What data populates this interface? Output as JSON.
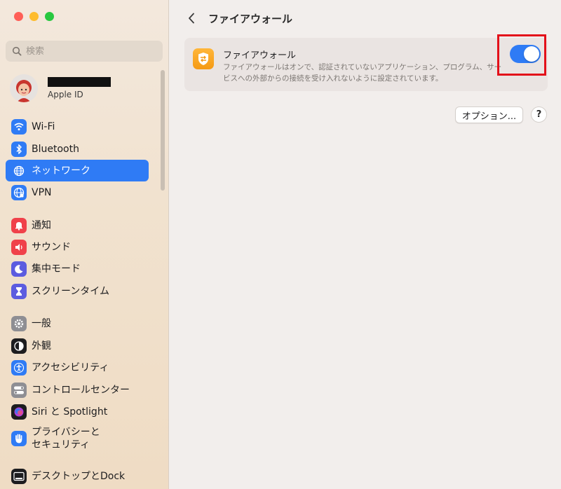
{
  "search": {
    "placeholder": "検索"
  },
  "account": {
    "subtitle": "Apple ID"
  },
  "sidebar": {
    "items": [
      {
        "label": "Wi-Fi",
        "icon": "wifi-icon",
        "color": "#2f7bf5"
      },
      {
        "label": "Bluetooth",
        "icon": "bluetooth-icon",
        "color": "#2f7bf5"
      },
      {
        "label": "ネットワーク",
        "icon": "globe-icon",
        "color": "#2f7bf5",
        "active": true
      },
      {
        "label": "VPN",
        "icon": "vpn-globe-icon",
        "color": "#2f7bf5"
      },
      {
        "label": "通知",
        "icon": "bell-icon",
        "color": "#f0414a"
      },
      {
        "label": "サウンド",
        "icon": "speaker-icon",
        "color": "#f0414a"
      },
      {
        "label": "集中モード",
        "icon": "moon-icon",
        "color": "#5c5ce0"
      },
      {
        "label": "スクリーンタイム",
        "icon": "hourglass-icon",
        "color": "#5c5ce0"
      },
      {
        "label": "一般",
        "icon": "gear-icon",
        "color": "#8e8e93"
      },
      {
        "label": "外観",
        "icon": "appearance-icon",
        "color": "#1d1d1f"
      },
      {
        "label": "アクセシビリティ",
        "icon": "accessibility-icon",
        "color": "#2f7bf5"
      },
      {
        "label": "コントロールセンター",
        "icon": "toggles-icon",
        "color": "#8e8e93"
      },
      {
        "label": "Siri と Spotlight",
        "icon": "siri-icon",
        "color": "#1d1d1f"
      },
      {
        "label_line1": "プライバシーと",
        "label_line2": "セキュリティ",
        "icon": "hand-icon",
        "color": "#2f7bf5"
      },
      {
        "label": "デスクトップとDock",
        "icon": "dock-icon",
        "color": "#1d1d1f"
      }
    ]
  },
  "main": {
    "title": "ファイアウォール",
    "firewall": {
      "title": "ファイアウォール",
      "description": "ファイアウォールはオンで、認証されていないアプリケーション、プログラム、サービスへの外部からの接続を受け入れないように設定されています。",
      "enabled": true
    },
    "options_label": "オプション...",
    "help_label": "?"
  }
}
